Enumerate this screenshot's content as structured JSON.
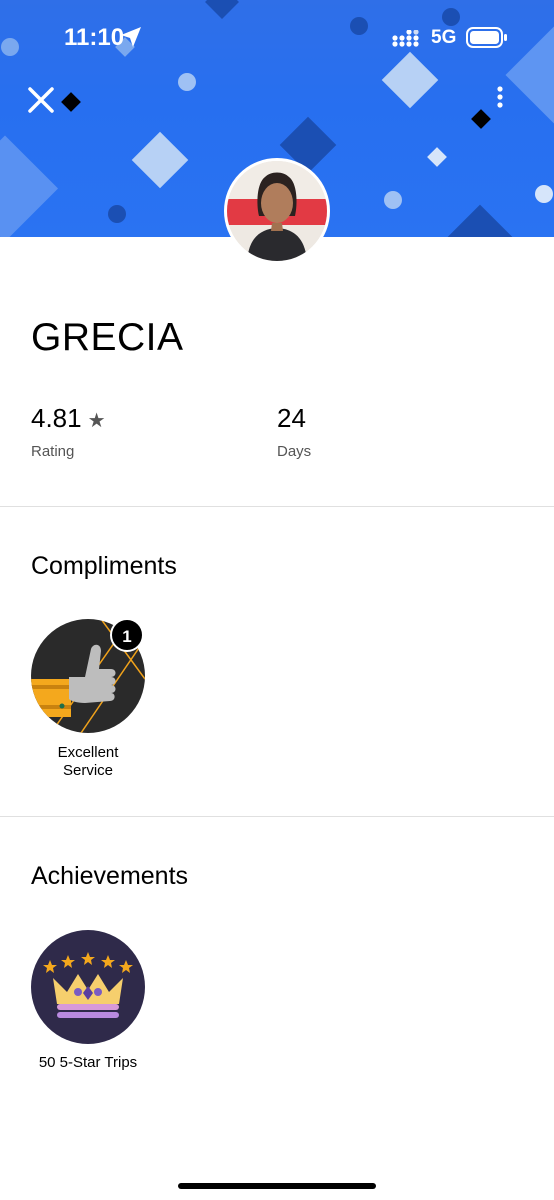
{
  "status_bar": {
    "time": "11:10",
    "network": "5G",
    "icons": [
      "location-arrow-icon",
      "signal-icon",
      "battery-icon"
    ]
  },
  "header": {
    "background_color": "#2a6ff0",
    "close_icon": "close-icon",
    "more_icon": "more-vertical-icon"
  },
  "profile": {
    "name": "GRECIA",
    "rating_value": "4.81",
    "rating_star": "★",
    "rating_label": "Rating",
    "days_value": "24",
    "days_label": "Days"
  },
  "compliments": {
    "title": "Compliments",
    "items": [
      {
        "label_line1": "Excellent",
        "label_line2": "Service",
        "count": "1",
        "icon": "thumbs-up-icon"
      }
    ]
  },
  "achievements": {
    "title": "Achievements",
    "items": [
      {
        "label": "50 5-Star Trips",
        "icon": "crown-icon"
      }
    ]
  }
}
